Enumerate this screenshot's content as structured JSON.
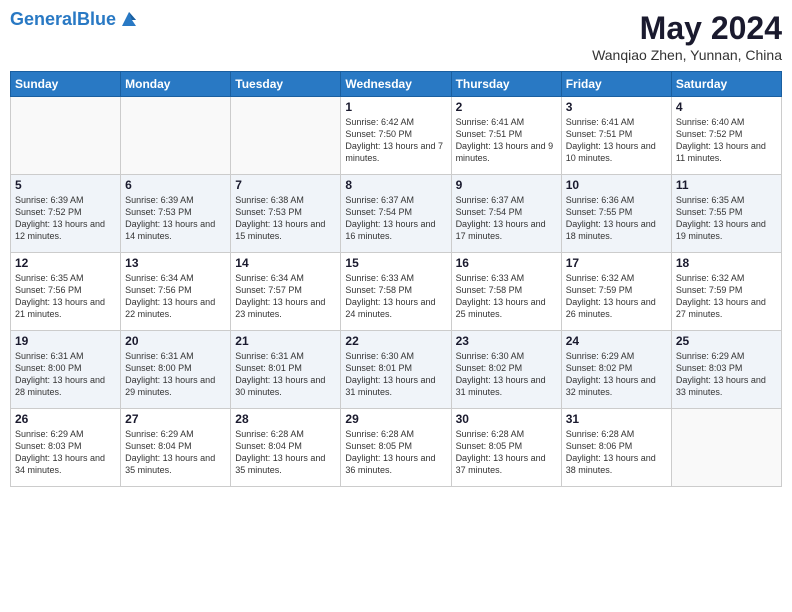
{
  "header": {
    "logo_line1": "General",
    "logo_line2": "Blue",
    "title": "May 2024",
    "subtitle": "Wanqiao Zhen, Yunnan, China"
  },
  "days_of_week": [
    "Sunday",
    "Monday",
    "Tuesday",
    "Wednesday",
    "Thursday",
    "Friday",
    "Saturday"
  ],
  "weeks": [
    [
      {
        "day": "",
        "info": ""
      },
      {
        "day": "",
        "info": ""
      },
      {
        "day": "",
        "info": ""
      },
      {
        "day": "1",
        "info": "Sunrise: 6:42 AM\nSunset: 7:50 PM\nDaylight: 13 hours and 7 minutes."
      },
      {
        "day": "2",
        "info": "Sunrise: 6:41 AM\nSunset: 7:51 PM\nDaylight: 13 hours and 9 minutes."
      },
      {
        "day": "3",
        "info": "Sunrise: 6:41 AM\nSunset: 7:51 PM\nDaylight: 13 hours and 10 minutes."
      },
      {
        "day": "4",
        "info": "Sunrise: 6:40 AM\nSunset: 7:52 PM\nDaylight: 13 hours and 11 minutes."
      }
    ],
    [
      {
        "day": "5",
        "info": "Sunrise: 6:39 AM\nSunset: 7:52 PM\nDaylight: 13 hours and 12 minutes."
      },
      {
        "day": "6",
        "info": "Sunrise: 6:39 AM\nSunset: 7:53 PM\nDaylight: 13 hours and 14 minutes."
      },
      {
        "day": "7",
        "info": "Sunrise: 6:38 AM\nSunset: 7:53 PM\nDaylight: 13 hours and 15 minutes."
      },
      {
        "day": "8",
        "info": "Sunrise: 6:37 AM\nSunset: 7:54 PM\nDaylight: 13 hours and 16 minutes."
      },
      {
        "day": "9",
        "info": "Sunrise: 6:37 AM\nSunset: 7:54 PM\nDaylight: 13 hours and 17 minutes."
      },
      {
        "day": "10",
        "info": "Sunrise: 6:36 AM\nSunset: 7:55 PM\nDaylight: 13 hours and 18 minutes."
      },
      {
        "day": "11",
        "info": "Sunrise: 6:35 AM\nSunset: 7:55 PM\nDaylight: 13 hours and 19 minutes."
      }
    ],
    [
      {
        "day": "12",
        "info": "Sunrise: 6:35 AM\nSunset: 7:56 PM\nDaylight: 13 hours and 21 minutes."
      },
      {
        "day": "13",
        "info": "Sunrise: 6:34 AM\nSunset: 7:56 PM\nDaylight: 13 hours and 22 minutes."
      },
      {
        "day": "14",
        "info": "Sunrise: 6:34 AM\nSunset: 7:57 PM\nDaylight: 13 hours and 23 minutes."
      },
      {
        "day": "15",
        "info": "Sunrise: 6:33 AM\nSunset: 7:58 PM\nDaylight: 13 hours and 24 minutes."
      },
      {
        "day": "16",
        "info": "Sunrise: 6:33 AM\nSunset: 7:58 PM\nDaylight: 13 hours and 25 minutes."
      },
      {
        "day": "17",
        "info": "Sunrise: 6:32 AM\nSunset: 7:59 PM\nDaylight: 13 hours and 26 minutes."
      },
      {
        "day": "18",
        "info": "Sunrise: 6:32 AM\nSunset: 7:59 PM\nDaylight: 13 hours and 27 minutes."
      }
    ],
    [
      {
        "day": "19",
        "info": "Sunrise: 6:31 AM\nSunset: 8:00 PM\nDaylight: 13 hours and 28 minutes."
      },
      {
        "day": "20",
        "info": "Sunrise: 6:31 AM\nSunset: 8:00 PM\nDaylight: 13 hours and 29 minutes."
      },
      {
        "day": "21",
        "info": "Sunrise: 6:31 AM\nSunset: 8:01 PM\nDaylight: 13 hours and 30 minutes."
      },
      {
        "day": "22",
        "info": "Sunrise: 6:30 AM\nSunset: 8:01 PM\nDaylight: 13 hours and 31 minutes."
      },
      {
        "day": "23",
        "info": "Sunrise: 6:30 AM\nSunset: 8:02 PM\nDaylight: 13 hours and 31 minutes."
      },
      {
        "day": "24",
        "info": "Sunrise: 6:29 AM\nSunset: 8:02 PM\nDaylight: 13 hours and 32 minutes."
      },
      {
        "day": "25",
        "info": "Sunrise: 6:29 AM\nSunset: 8:03 PM\nDaylight: 13 hours and 33 minutes."
      }
    ],
    [
      {
        "day": "26",
        "info": "Sunrise: 6:29 AM\nSunset: 8:03 PM\nDaylight: 13 hours and 34 minutes."
      },
      {
        "day": "27",
        "info": "Sunrise: 6:29 AM\nSunset: 8:04 PM\nDaylight: 13 hours and 35 minutes."
      },
      {
        "day": "28",
        "info": "Sunrise: 6:28 AM\nSunset: 8:04 PM\nDaylight: 13 hours and 35 minutes."
      },
      {
        "day": "29",
        "info": "Sunrise: 6:28 AM\nSunset: 8:05 PM\nDaylight: 13 hours and 36 minutes."
      },
      {
        "day": "30",
        "info": "Sunrise: 6:28 AM\nSunset: 8:05 PM\nDaylight: 13 hours and 37 minutes."
      },
      {
        "day": "31",
        "info": "Sunrise: 6:28 AM\nSunset: 8:06 PM\nDaylight: 13 hours and 38 minutes."
      },
      {
        "day": "",
        "info": ""
      }
    ]
  ]
}
